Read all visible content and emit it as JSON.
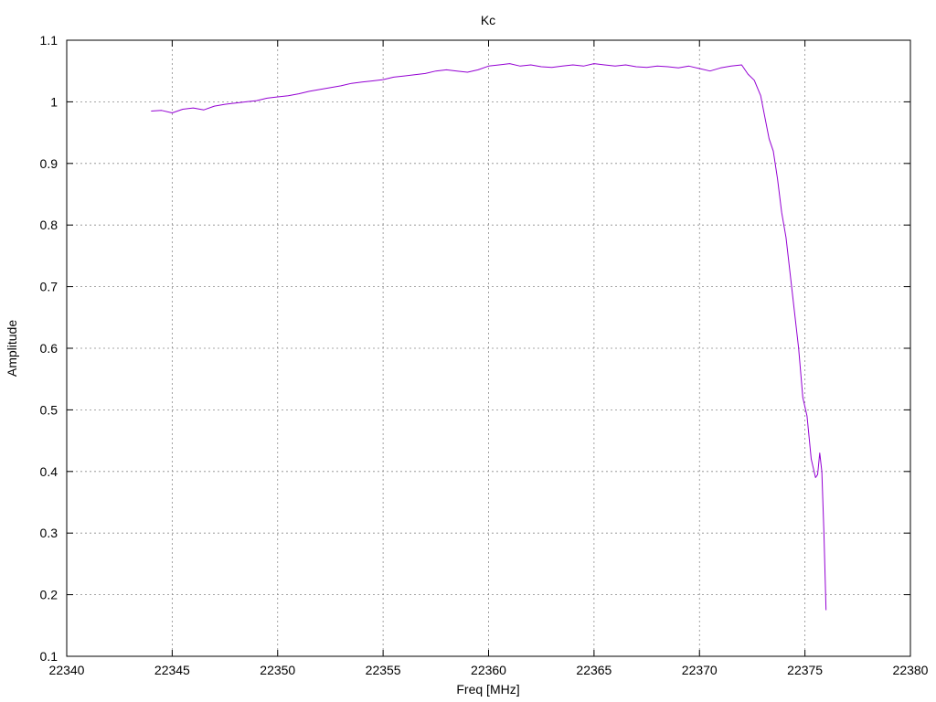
{
  "chart_data": {
    "type": "line",
    "title": "Kc",
    "xlabel": "Freq [MHz]",
    "ylabel": "Amplitude",
    "xlim": [
      22340,
      22380
    ],
    "ylim": [
      0.1,
      1.1
    ],
    "xticks": [
      22340,
      22345,
      22350,
      22355,
      22360,
      22365,
      22370,
      22375,
      22380
    ],
    "yticks": [
      0.1,
      0.2,
      0.3,
      0.4,
      0.5,
      0.6,
      0.7,
      0.8,
      0.9,
      1,
      1.1
    ],
    "xtick_labels": [
      "22340",
      "22345",
      "22350",
      "22355",
      "22360",
      "22365",
      "22370",
      "22375",
      "22380"
    ],
    "ytick_labels": [
      "0.1",
      "0.2",
      "0.3",
      "0.4",
      "0.5",
      "0.6",
      "0.7",
      "0.8",
      "0.9",
      "1",
      "1.1"
    ],
    "grid": true,
    "series": [
      {
        "color": "#9400d3",
        "x": [
          22344.0,
          22344.5,
          22345.0,
          22345.5,
          22346.0,
          22346.5,
          22347.0,
          22347.5,
          22348.0,
          22348.5,
          22349.0,
          22349.5,
          22350.0,
          22350.5,
          22351.0,
          22351.5,
          22352.0,
          22352.5,
          22353.0,
          22353.5,
          22354.0,
          22354.5,
          22355.0,
          22355.5,
          22356.0,
          22356.5,
          22357.0,
          22357.5,
          22358.0,
          22358.5,
          22359.0,
          22359.5,
          22360.0,
          22360.5,
          22361.0,
          22361.5,
          22362.0,
          22362.5,
          22363.0,
          22363.5,
          22364.0,
          22364.5,
          22365.0,
          22365.5,
          22366.0,
          22366.5,
          22367.0,
          22367.5,
          22368.0,
          22368.5,
          22369.0,
          22369.5,
          22370.0,
          22370.5,
          22371.0,
          22371.5,
          22372.0,
          22372.3,
          22372.6,
          22372.9,
          22373.1,
          22373.3,
          22373.5,
          22373.7,
          22373.9,
          22374.1,
          22374.3,
          22374.5,
          22374.7,
          22374.9,
          22375.1,
          22375.3,
          22375.5,
          22375.6,
          22375.7,
          22375.8,
          22375.9,
          22376.0
        ],
        "y": [
          0.985,
          0.986,
          0.982,
          0.988,
          0.99,
          0.987,
          0.993,
          0.996,
          0.998,
          1.0,
          1.002,
          1.006,
          1.008,
          1.01,
          1.013,
          1.017,
          1.02,
          1.023,
          1.026,
          1.03,
          1.032,
          1.034,
          1.036,
          1.04,
          1.042,
          1.044,
          1.046,
          1.05,
          1.052,
          1.05,
          1.048,
          1.052,
          1.058,
          1.06,
          1.062,
          1.058,
          1.06,
          1.057,
          1.056,
          1.058,
          1.06,
          1.058,
          1.062,
          1.06,
          1.058,
          1.06,
          1.057,
          1.056,
          1.058,
          1.057,
          1.055,
          1.058,
          1.054,
          1.05,
          1.055,
          1.058,
          1.06,
          1.045,
          1.035,
          1.01,
          0.975,
          0.94,
          0.92,
          0.875,
          0.82,
          0.78,
          0.72,
          0.66,
          0.6,
          0.52,
          0.49,
          0.42,
          0.39,
          0.395,
          0.43,
          0.4,
          0.3,
          0.175
        ]
      }
    ]
  }
}
